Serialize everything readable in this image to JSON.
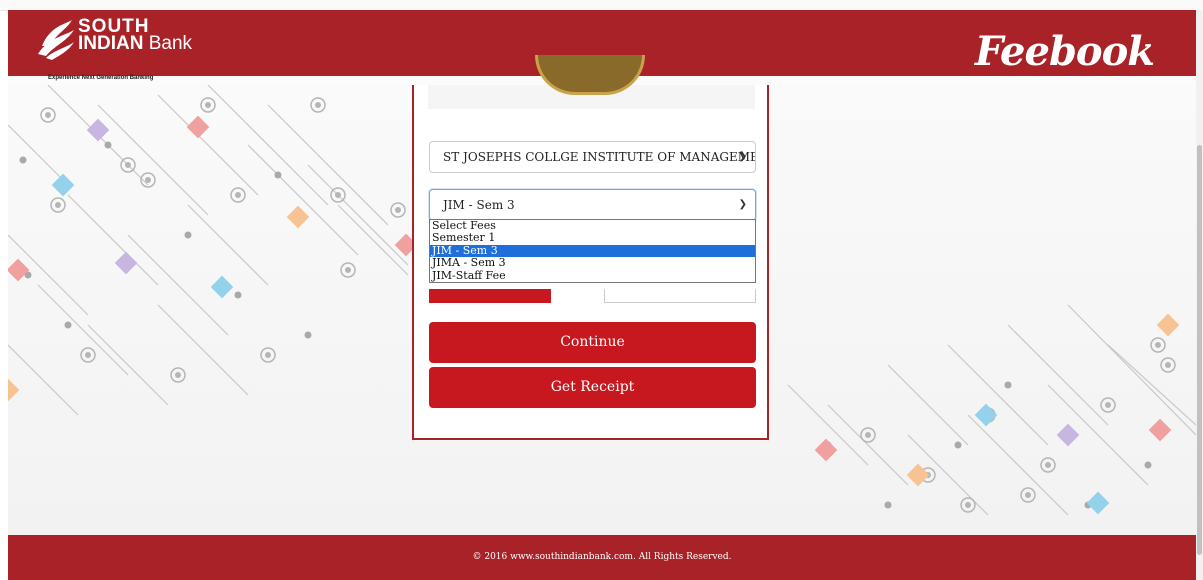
{
  "header": {
    "logo_line1": "SOUTH",
    "logo_line2a": "INDIAN",
    "logo_line2b": " Bank",
    "tagline": "Experience Next Generation Banking",
    "brand": "Feebook"
  },
  "form": {
    "institution_select_value": "ST JOSEPHS COLLGE INSTITUTE OF MANAGEMENT",
    "fee_select_value": "JIM - Sem 3",
    "fee_options": [
      "Select Fees",
      "Semester 1",
      "JIM - Sem 3",
      "JIMA - Sem 3",
      "JIM-Staff Fee"
    ],
    "fee_selected_index": 2,
    "continue_label": "Continue",
    "receipt_label": "Get Receipt"
  },
  "footer": {
    "copyright": "© 2016 www.southindianbank.com. All Rights Reserved."
  },
  "colors": {
    "brand_red": "#a92228",
    "button_red": "#c8181f",
    "highlight_blue": "#1e6fd9"
  },
  "icons": {
    "logo": "south-indian-bank-logo-icon",
    "chevron": "chevron-down-icon"
  }
}
